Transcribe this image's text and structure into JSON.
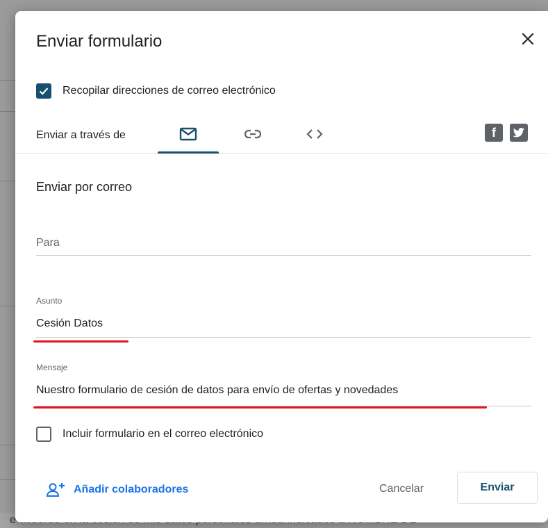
{
  "dialog": {
    "title": "Enviar formulario",
    "collect_emails_label": "Recopilar direcciones de correo electrónico",
    "collect_emails_checked": true,
    "send_via_label": "Enviar a través de",
    "tabs": [
      {
        "icon": "email-icon",
        "active": true
      },
      {
        "icon": "link-icon",
        "active": false
      },
      {
        "icon": "embed-code-icon",
        "active": false
      }
    ],
    "social": {
      "facebook": "f",
      "twitter_icon": "twitter-icon"
    },
    "section_title": "Enviar por correo",
    "to": {
      "placeholder": "Para",
      "value": ""
    },
    "subject": {
      "label": "Asunto",
      "value": "Cesión Datos"
    },
    "message": {
      "label": "Mensaje",
      "value": "Nuestro formulario de cesión de datos para envío de ofertas y novedades"
    },
    "include_form_label": "Incluir formulario en el correo electrónico",
    "include_form_checked": false,
    "add_collaborators_label": "Añadir colaboradores",
    "cancel_label": "Cancelar",
    "send_label": "Enviar"
  },
  "background": {
    "bottom_text": "e acuerdo en la cesión de mis datos personales arriba indicados a NOMBRE DE"
  },
  "colors": {
    "accent": "#174f6e",
    "link": "#1a73e8",
    "highlight": "#e1141d"
  }
}
